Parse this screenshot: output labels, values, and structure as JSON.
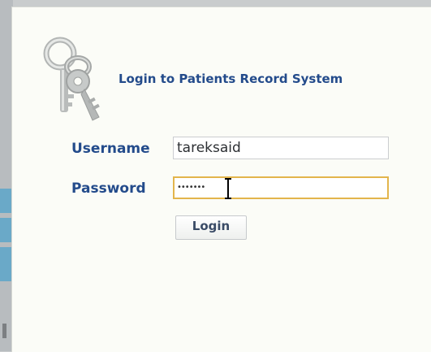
{
  "header": {
    "title": "Login to Patients Record System",
    "icon": "keys-icon"
  },
  "form": {
    "username_label": "Username",
    "username_value": "tareksaid",
    "password_label": "Password",
    "password_mask": "•••••••",
    "login_button": "Login"
  },
  "colors": {
    "label_text": "#234b8b",
    "panel_background": "#fbfcf7",
    "focus_border": "#e3b54c",
    "side_tab": "#6aa9c8"
  }
}
